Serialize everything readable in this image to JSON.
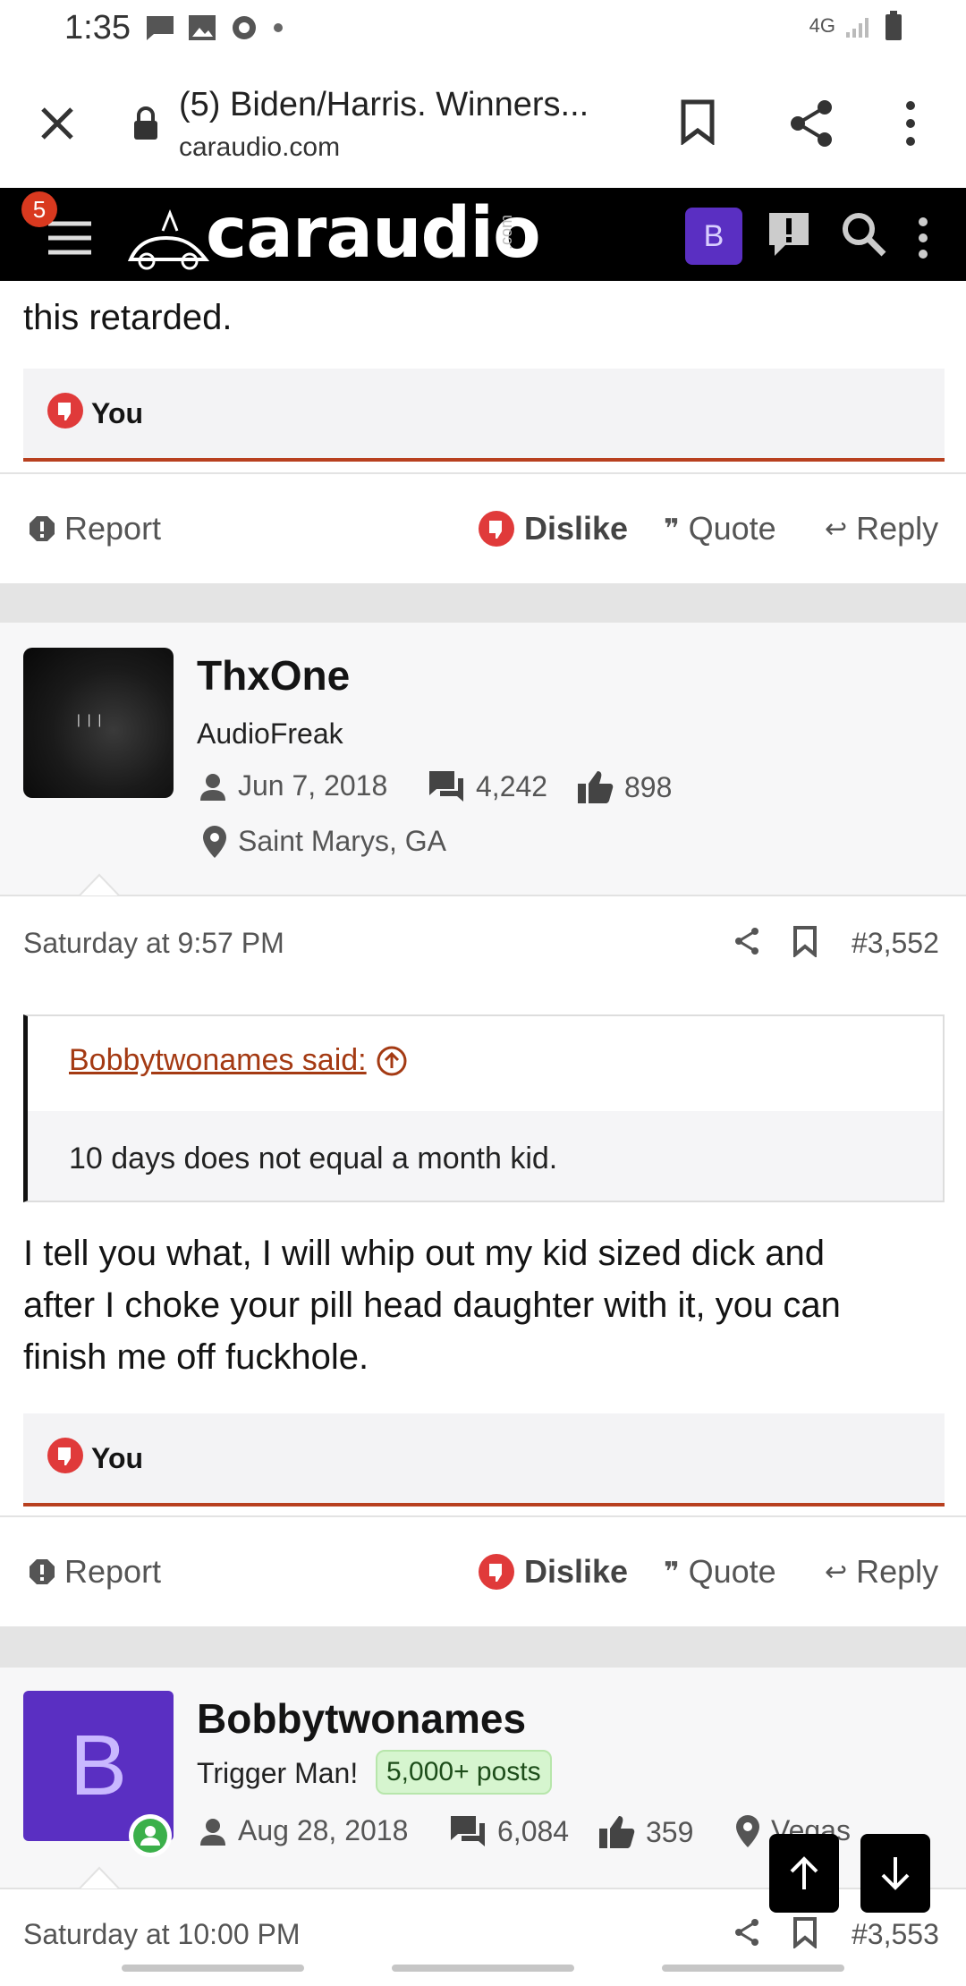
{
  "status_bar": {
    "time": "1:35",
    "network": "4G"
  },
  "browser": {
    "tab_title": "(5) Biden/Harris. Winners...",
    "domain": "caraudio.com"
  },
  "site_header": {
    "notification_count": "5",
    "logo": "caraudio",
    "logo_suffix": ".com",
    "user_initial": "B"
  },
  "post_prev": {
    "text_tail": "this retarded.",
    "reaction_user": "You",
    "actions": {
      "report": "Report",
      "dislike": "Dislike",
      "quote": "Quote",
      "reply": "Reply"
    }
  },
  "post_3552": {
    "author": {
      "name": "ThxOne",
      "title": "AudioFreak",
      "joined": "Jun 7, 2018",
      "messages": "4,242",
      "likes": "898",
      "location": "Saint Marys, GA"
    },
    "timestamp": "Saturday at 9:57 PM",
    "number": "#3,552",
    "quote": {
      "attribution": "Bobbytwonames said:",
      "text": "10 days does not equal a month kid."
    },
    "body_lines": [
      "I tell you what, I will whip out my kid sized dick and",
      "after I choke your pill head daughter with it, you can",
      "finish me off fuckhole."
    ],
    "reaction_user": "You",
    "actions": {
      "report": "Report",
      "dislike": "Dislike",
      "quote": "Quote",
      "reply": "Reply"
    }
  },
  "post_3553": {
    "author": {
      "name": "Bobbytwonames",
      "initial": "B",
      "title": "Trigger Man!",
      "badge": "5,000+ posts",
      "joined": "Aug 28, 2018",
      "messages": "6,084",
      "likes": "359",
      "location": "Vegas"
    },
    "timestamp": "Saturday at 10:00 PM",
    "number": "#3,553"
  },
  "colors": {
    "accent_red": "#b8401f",
    "link": "#a43a13",
    "avatar_purple": "#5a2fc2",
    "badge_green": "#d6f5cf"
  }
}
